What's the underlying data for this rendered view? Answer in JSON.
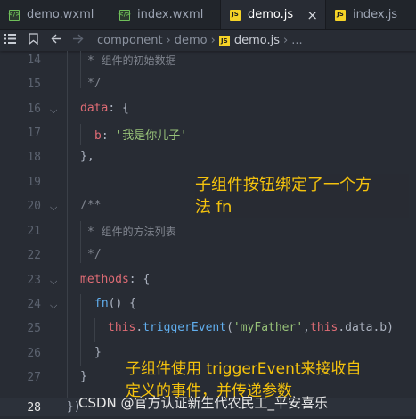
{
  "tabs": [
    {
      "label": "demo.wxml",
      "icon": "wxml-file-icon",
      "active": false
    },
    {
      "label": "index.wxml",
      "icon": "wxml-file-icon",
      "active": false
    },
    {
      "label": "demo.js",
      "icon": "js-file-icon",
      "active": true,
      "close": "×"
    },
    {
      "label": "index.js",
      "icon": "js-file-icon",
      "active": false
    }
  ],
  "js_badge": "JS",
  "breadcrumb": {
    "items": [
      "component",
      "demo",
      "demo.js",
      "..."
    ],
    "separator": "›"
  },
  "gutter": {
    "lines": [
      "14",
      "15",
      "16",
      "17",
      "18",
      "19",
      "20",
      "21",
      "22",
      "23",
      "24",
      "25",
      "26",
      "27",
      "28"
    ],
    "current": "28"
  },
  "code": {
    "l14_star": "*",
    "l14_text": "组件的初始数据",
    "l15": "*/",
    "l16_key": "data",
    "l16_rest": ": {",
    "l17_key": "b",
    "l17_colon": ": ",
    "l17_str": "'我是你儿子'",
    "l18": "},",
    "l20": "/**",
    "l21_star": "*",
    "l21_text": "组件的方法列表",
    "l22": "*/",
    "l23_key": "methods",
    "l23_rest": ": {",
    "l24_fn": "fn",
    "l24_rest": "() {",
    "l25_this": "this",
    "l25_dot": ".",
    "l25_call": "triggerEvent",
    "l25_open": "(",
    "l25_str": "'myFather'",
    "l25_comma": ",",
    "l25_this2": "this",
    "l25_tail": ".data.b)",
    "l26": "}",
    "l27": "}",
    "l28": "})"
  },
  "annotations": {
    "note1_line1": "子组件按钮绑定了一个方",
    "note1_line2": "法 fn",
    "note2_line1": "子组件使用 triggerEvent来接收自",
    "note2_line2": "定义的事件，并传递参数"
  },
  "watermark": "CSDN @官方认证新生代农民工_平安喜乐",
  "colors": {
    "accent_note": "#f4c20d",
    "bg": "#282c34",
    "keyword": "#c678dd",
    "string": "#98c379",
    "property": "#e06c75",
    "function": "#61afef"
  }
}
